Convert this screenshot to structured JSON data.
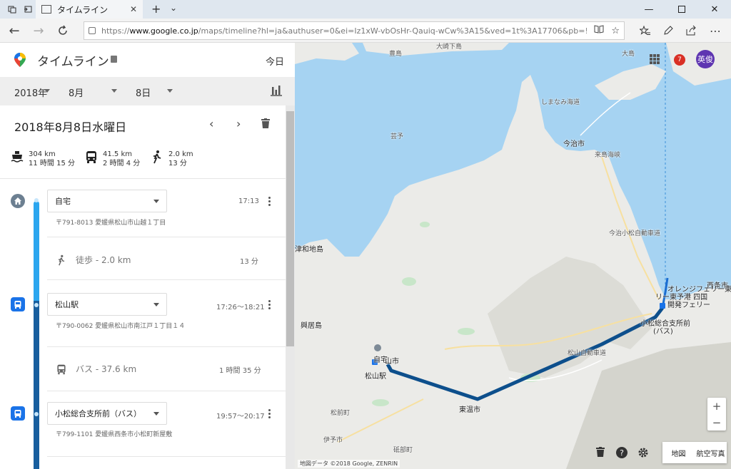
{
  "browser": {
    "tab_title": "タイムライン",
    "new_tab": "+",
    "tab_menu": "⌄",
    "url_gray_prefix": "https://",
    "url_host": "www.google.co.jp",
    "url_rest": "/maps/timeline?hl=ja&authuser=0&ei=Iz1xW-vbOsHr-Qauiq-wCw%3A15&ved=1t%3A17706&pb=!1m2!1m1!1s2018-08-08"
  },
  "panel": {
    "title": "タイムライン",
    "today": "今日",
    "year": "2018年",
    "month": "8月",
    "day": "8日",
    "day_title": "2018年8月8日水曜日",
    "summary": [
      {
        "icon": "ferry-icon",
        "distance": "304 km",
        "duration": "11 時間 15 分"
      },
      {
        "icon": "bus-icon",
        "distance": "41.5 km",
        "duration": "2 時間 4 分"
      },
      {
        "icon": "walk-icon",
        "distance": "2.0 km",
        "duration": "13 分"
      }
    ],
    "places": [
      {
        "name": "自宅",
        "time": "17:13",
        "address": "〒791-8013 愛媛県松山市山越１丁目",
        "icon": "home-icon"
      },
      {
        "name": "松山駅",
        "time": "17:26〜18:21",
        "address": "〒790-0062 愛媛県松山市南江戸１丁目１４",
        "icon": "bus-icon"
      },
      {
        "name": "小松総合支所前（バス）",
        "time": "19:57〜20:17",
        "address": "〒799-1101 愛媛県西条市小松町新屋敷",
        "icon": "bus-icon"
      }
    ],
    "moves": [
      {
        "label": "徒歩 - 2.0 km",
        "duration": "13 分",
        "icon": "walk-icon"
      },
      {
        "label": "バス - 37.6 km",
        "duration": "1 時間 35 分",
        "icon": "bus-icon"
      }
    ]
  },
  "map": {
    "notifications": "7",
    "user": "英俊",
    "zoom_in": "+",
    "zoom_out": "−",
    "type_map": "地図",
    "type_satellite": "航空写真",
    "attribution": "地図データ ©2018 Google, ZENRIN",
    "labels": {
      "toyoshima": "豊島",
      "omishima": "大崎下島",
      "oshima": "大島",
      "imabari": "今治市",
      "shimanami": "しまなみ海道",
      "kurushima": "来島海峡",
      "geiyo": "芸予",
      "tsuki": "津和地島",
      "gogo": "興居島",
      "home": "自宅",
      "matsuyama_city": "山市",
      "matsuyama_stn": "松山駅",
      "toon": "東温市",
      "iyo": "伊予市",
      "matsumae": "松前町",
      "tobe": "砥部町",
      "saijo": "西条市",
      "ferry": "オレンジフェリー東予",
      "ferry2": "リー東予港 四国",
      "ferry3": "開発フェリー",
      "komatsu": "小松総合支所前",
      "komatsu2": "(バス)",
      "expressway": "松山自動車道",
      "kihoku": "今治小松自動車道"
    }
  }
}
